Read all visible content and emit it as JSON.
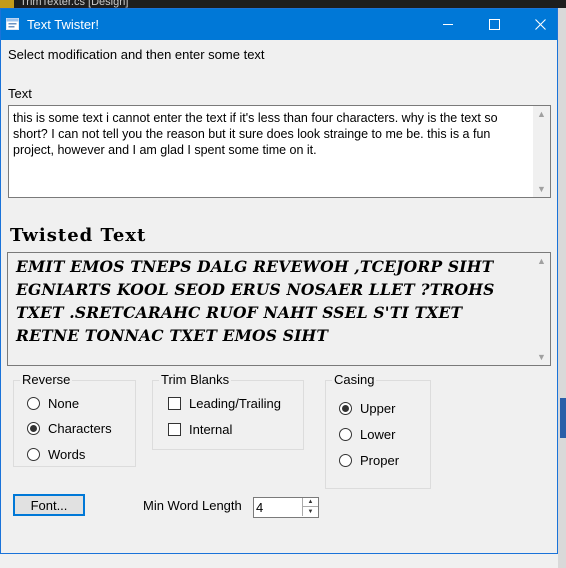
{
  "background": {
    "editor_tab": "TrimTexter.cs [Design]"
  },
  "window": {
    "title": "Text Twister!",
    "buttons": {
      "minimize": "—",
      "maximize": "☐",
      "close": "✕"
    },
    "accent": "#0078d7"
  },
  "instructions": "Select modification  and then enter some text",
  "input": {
    "label": "Text",
    "value": "this is some text i cannot enter the text if it's less than four characters. why is the text so short? I can not tell you the reason but it sure does look strainge to me be. this is a fun project, however and I am glad I spent some time on it."
  },
  "output": {
    "heading": "Twisted Text",
    "value": "EMIT EMOS TNEPS DALG REVEWOH ,TCEJORP SIHT EGNIARTS KOOL SEOD ERUS NOSAER LLET ?TROHS TXET .SRETCARAHC RUOF NAHT SSEL S'TI TXET RETNE TONNAC TXET EMOS SIHT"
  },
  "reverse": {
    "title": "Reverse",
    "options": [
      "None",
      "Characters",
      "Words"
    ],
    "selected": "Characters"
  },
  "trim": {
    "title": "Trim Blanks",
    "options": [
      "Leading/Trailing",
      "Internal"
    ],
    "checked": []
  },
  "casing": {
    "title": "Casing",
    "options": [
      "Upper",
      "Lower",
      "Proper"
    ],
    "selected": "Upper"
  },
  "font_button": "Font...",
  "min_word_length": {
    "label": "Min Word Length",
    "value": "4"
  }
}
